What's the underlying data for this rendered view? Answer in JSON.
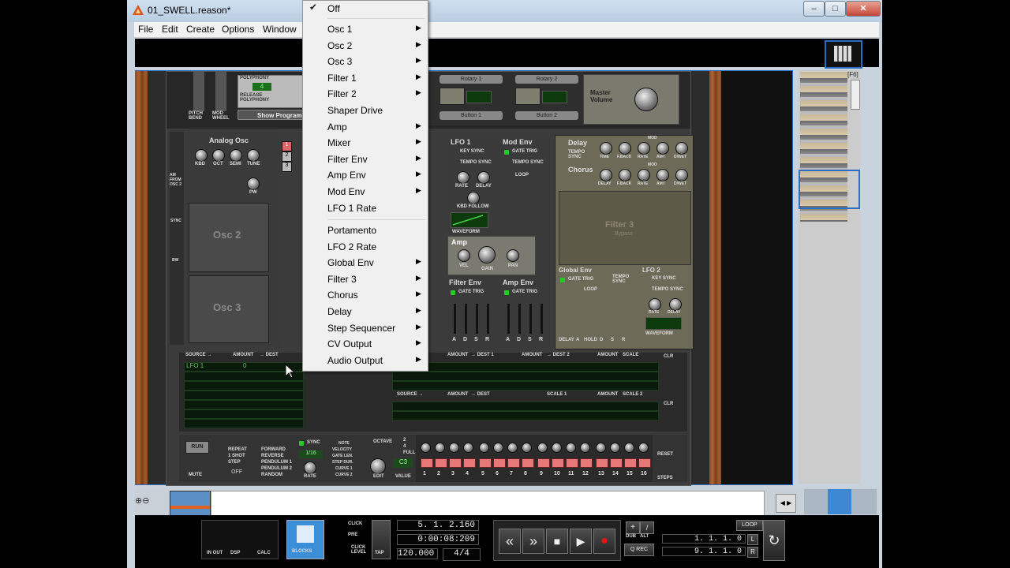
{
  "window": {
    "title": "01_SWELL.reason*"
  },
  "menubar": {
    "items": [
      "File",
      "Edit",
      "Create",
      "Options",
      "Window"
    ]
  },
  "dropdown": {
    "checked_item": "Off",
    "items": [
      {
        "label": "Off",
        "checked": true
      },
      {
        "label": "Osc 1",
        "submenu": true
      },
      {
        "label": "Osc 2",
        "submenu": true
      },
      {
        "label": "Osc 3",
        "submenu": true
      },
      {
        "label": "Filter 1",
        "submenu": true
      },
      {
        "label": "Filter 2",
        "submenu": true
      },
      {
        "label": "Shaper Drive"
      },
      {
        "label": "Amp",
        "submenu": true
      },
      {
        "label": "Mixer",
        "submenu": true
      },
      {
        "label": "Filter Env",
        "submenu": true
      },
      {
        "label": "Amp Env",
        "submenu": true
      },
      {
        "label": "Mod Env",
        "submenu": true
      },
      {
        "label": "LFO 1 Rate"
      },
      {
        "label": "Portamento"
      },
      {
        "label": "LFO 2 Rate"
      },
      {
        "label": "Global Env",
        "submenu": true
      },
      {
        "label": "Filter 3",
        "submenu": true
      },
      {
        "label": "Chorus",
        "submenu": true
      },
      {
        "label": "Delay",
        "submenu": true
      },
      {
        "label": "Step Sequencer",
        "submenu": true
      },
      {
        "label": "CV Output",
        "submenu": true
      },
      {
        "label": "Audio Output",
        "submenu": true
      }
    ]
  },
  "device": {
    "top_left": {
      "polyphony_label": "POLYPHONY",
      "release_polyphony_label": "RELEASE POLYPHONY",
      "pitch_bend": "PITCH BEND",
      "mod_wheel": "MOD WHEEL",
      "show_programmer": "Show Program"
    },
    "rotaries": [
      "Rotary 1",
      "Rotary 2"
    ],
    "buttons": [
      "Button 1",
      "Button 2"
    ],
    "master_volume": "Master Volume",
    "analog_osc": {
      "title": "Analog Osc",
      "knobs": [
        "KBD",
        "OCT",
        "SEMI",
        "TUNE"
      ],
      "pw": "PW",
      "am_from_osc2": "AM FROM OSC 2"
    },
    "osc2": "Osc 2",
    "osc3": "Osc 3",
    "sync": "SYNC",
    "bw": "BW",
    "lfo1": {
      "title": "LFO 1",
      "key_sync": "KEY SYNC",
      "tempo_sync": "TEMPO SYNC",
      "rate": "RATE",
      "delay": "DELAY",
      "kbd_follow": "KBD FOLLOW",
      "waveform": "WAVEFORM"
    },
    "mod_env": {
      "title": "Mod Env",
      "gate_trig": "GATE TRIG",
      "tempo_sync": "TEMPO SYNC",
      "loop": "LOOP",
      "faders": [
        "DELAY",
        "A",
        "D",
        "R"
      ]
    },
    "delay": {
      "title": "Delay",
      "tempo_sync": "TEMPO SYNC",
      "knobs": [
        "TIME",
        "F.BACK",
        "RATE",
        "AMT",
        "D/WET"
      ],
      "mod": "MOD"
    },
    "chorus": {
      "title": "Chorus",
      "knobs": [
        "DELAY",
        "F.BACK",
        "RATE",
        "AMT",
        "D/WET"
      ],
      "mod": "MOD"
    },
    "amp": {
      "title": "Amp",
      "knobs": [
        "VEL",
        "GAIN",
        "PAN"
      ]
    },
    "filter3": {
      "title": "Filter 3",
      "subtitle": "Bypass"
    },
    "filter_env": {
      "title": "Filter Env",
      "gate_trig": "GATE TRIG",
      "faders": [
        "A",
        "D",
        "S",
        "R"
      ]
    },
    "amp_env": {
      "title": "Amp Env",
      "gate_trig": "GATE TRIG",
      "faders": [
        "A",
        "D",
        "S",
        "R"
      ]
    },
    "global_env": {
      "title": "Global Env",
      "gate_trig": "GATE TRIG",
      "tempo_sync": "TEMPO SYNC",
      "loop": "LOOP",
      "faders": [
        "DELAY",
        "A",
        "HOLD",
        "D",
        "S",
        "R"
      ]
    },
    "lfo2": {
      "title": "LFO 2",
      "key_sync": "KEY SYNC",
      "tempo_sync": "TEMPO SYNC",
      "rate": "RATE",
      "delay": "DELAY",
      "waveform": "WAVEFORM"
    },
    "mod_matrix": {
      "headers_left": [
        "SOURCE →",
        "AMOUNT",
        "→ DEST"
      ],
      "headers_right": [
        "AMOUNT",
        "→ DEST 1",
        "AMOUNT",
        "→ DEST 2",
        "AMOUNT",
        "SCALE"
      ],
      "headers_right2": [
        "SOURCE →",
        "AMOUNT",
        "→ DEST",
        "SCALE 1",
        "AMOUNT",
        "SCALE 2"
      ],
      "first_source": "LFO 1",
      "amount_value": "0",
      "clr": "CLR"
    },
    "step_seq": {
      "run": "RUN",
      "mute": "MUTE",
      "modes": [
        "REPEAT",
        "1 SHOT",
        "STEP"
      ],
      "directions": [
        "FORWARD",
        "REVERSE",
        "PENDULUM 1",
        "PENDULUM 2",
        "RANDOM"
      ],
      "off": "OFF",
      "sync": "SYNC",
      "rate_value": "1/16",
      "rate": "RATE",
      "targets": [
        "NOTE",
        "VELOCITY",
        "GATE LEN.",
        "STEP DUR.",
        "CURVE 1",
        "CURVE 2"
      ],
      "octave": "OCTAVE",
      "octave_opts": [
        "2",
        "4",
        "FULL"
      ],
      "edit": "EDIT",
      "value": "VALUE",
      "value_display": "C3",
      "steps": [
        "1",
        "2",
        "3",
        "4",
        "5",
        "6",
        "7",
        "8",
        "9",
        "10",
        "11",
        "12",
        "13",
        "14",
        "15",
        "16"
      ],
      "reset": "RESET",
      "steps_label": "STEPS"
    }
  },
  "nav": {
    "f6": "[F6]"
  },
  "transport": {
    "in_out": "IN OUT",
    "dsp": "DSP",
    "calc": "CALC",
    "blocks": "BLOCKS",
    "click": "CLICK",
    "pre": "PRE",
    "click_level": "CLICK LEVEL",
    "tap": "TAP",
    "position": "5. 1. 2.160",
    "time": "0:00:08:209",
    "tempo": "120.000",
    "signature": "4/4",
    "dub": "DUB",
    "alt": "ALT",
    "q_rec": "Q REC",
    "loop": "LOOP",
    "left_locator": "1. 1. 1.   0",
    "right_locator": "9. 1. 1.   0",
    "l": "L",
    "r": "R"
  }
}
